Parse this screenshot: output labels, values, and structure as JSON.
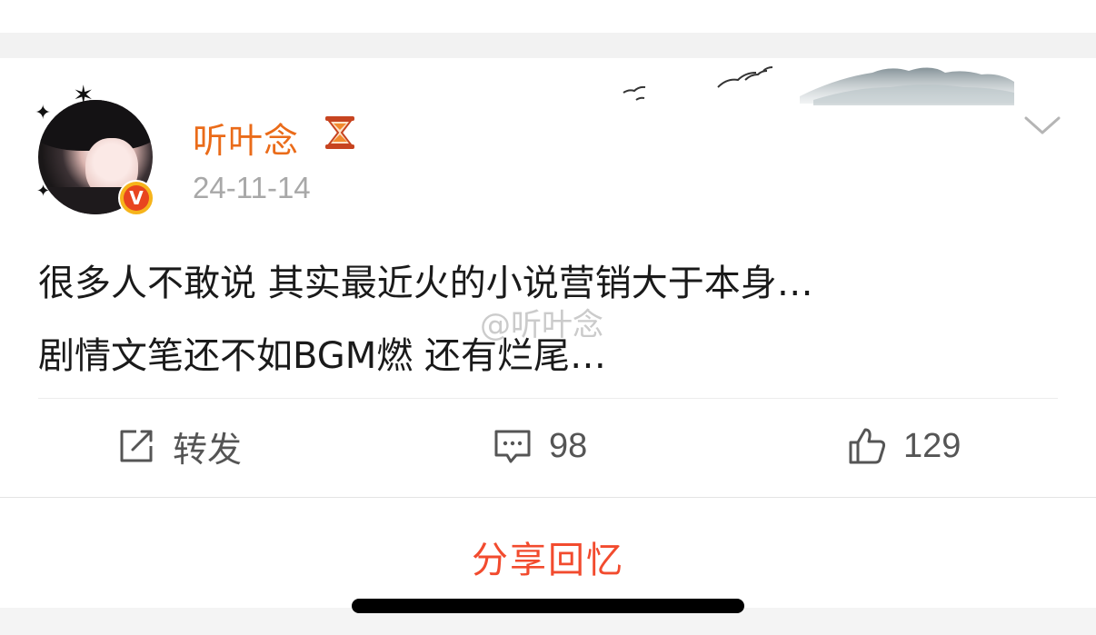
{
  "post": {
    "username": "听叶念",
    "user_badge_icon": "hourglass-icon",
    "verified_badge": "V",
    "date": "24-11-14",
    "text_line1": "很多人不敢说 其实最近火的小说营销大于本身…",
    "text_line2": "剧情文笔还不如BGM燃 还有烂尾…",
    "watermark": "@听叶念"
  },
  "actions": {
    "repost_label": "转发",
    "comment_count": "98",
    "like_count": "129"
  },
  "footer": {
    "share_label": "分享回忆"
  },
  "colors": {
    "username": "#ea6b19",
    "share": "#f24b2e",
    "date": "#a8a8a8",
    "text": "#1a1a1a",
    "badge_outer": "#f6b41b",
    "badge_inner": "#e8451f"
  }
}
